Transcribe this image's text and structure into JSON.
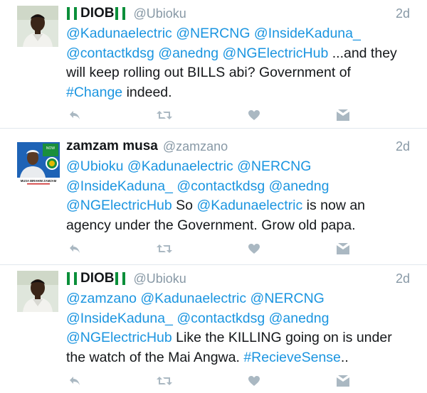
{
  "tweets": [
    {
      "name": "DIOB",
      "handle": "@Ubioku",
      "time": "2d",
      "lines": [
        [
          {
            "t": "@Kadunaelectric @NERCNG @InsideKaduna_",
            "link": true
          }
        ],
        [
          {
            "t": "@contactkdsg @anedng @NGElectricHub",
            "link": true
          },
          {
            "t": " ...and they",
            "link": false
          }
        ],
        [
          {
            "t": "will keep rolling out BILLS abi? Government of",
            "link": false
          }
        ],
        [
          {
            "t": "#Change",
            "link": true
          },
          {
            "t": " indeed.",
            "link": false
          }
        ]
      ]
    },
    {
      "name": "zamzam musa",
      "handle": "@zamzano",
      "time": "2d",
      "avatar_caption": "MUSA IBRAHIM ZAMZAM",
      "lines": [
        [
          {
            "t": "@Ubioku @Kadunaelectric @NERCNG",
            "link": true
          }
        ],
        [
          {
            "t": "@InsideKaduna_ @contactkdsg @anedng",
            "link": true
          }
        ],
        [
          {
            "t": "@NGElectricHub",
            "link": true
          },
          {
            "t": " So ",
            "link": false
          },
          {
            "t": "@Kadunaelectric",
            "link": true
          },
          {
            "t": " is now an",
            "link": false
          }
        ],
        [
          {
            "t": "agency under the Government. Grow old papa.",
            "link": false
          }
        ]
      ]
    },
    {
      "name": "DIOB",
      "handle": "@Ubioku",
      "time": "2d",
      "lines": [
        [
          {
            "t": "@zamzano @Kadunaelectric @NERCNG",
            "link": true
          }
        ],
        [
          {
            "t": "@InsideKaduna_ @contactkdsg @anedng",
            "link": true
          }
        ],
        [
          {
            "t": "@NGElectricHub",
            "link": true
          },
          {
            "t": " Like the KILLING going on is under",
            "link": false
          }
        ],
        [
          {
            "t": "the watch of the Mai Angwa. ",
            "link": false
          },
          {
            "t": "#RecieveSense",
            "link": true
          },
          {
            "t": "..",
            "link": false
          }
        ]
      ]
    }
  ],
  "actions": {
    "reply": "reply-icon",
    "retweet": "retweet-icon",
    "like": "heart-icon",
    "message": "direct-message-icon"
  },
  "colors": {
    "link": "#1b95e0",
    "muted": "#8899a6",
    "icon": "#aab8c2",
    "flag_green": "#0b8f3a"
  }
}
